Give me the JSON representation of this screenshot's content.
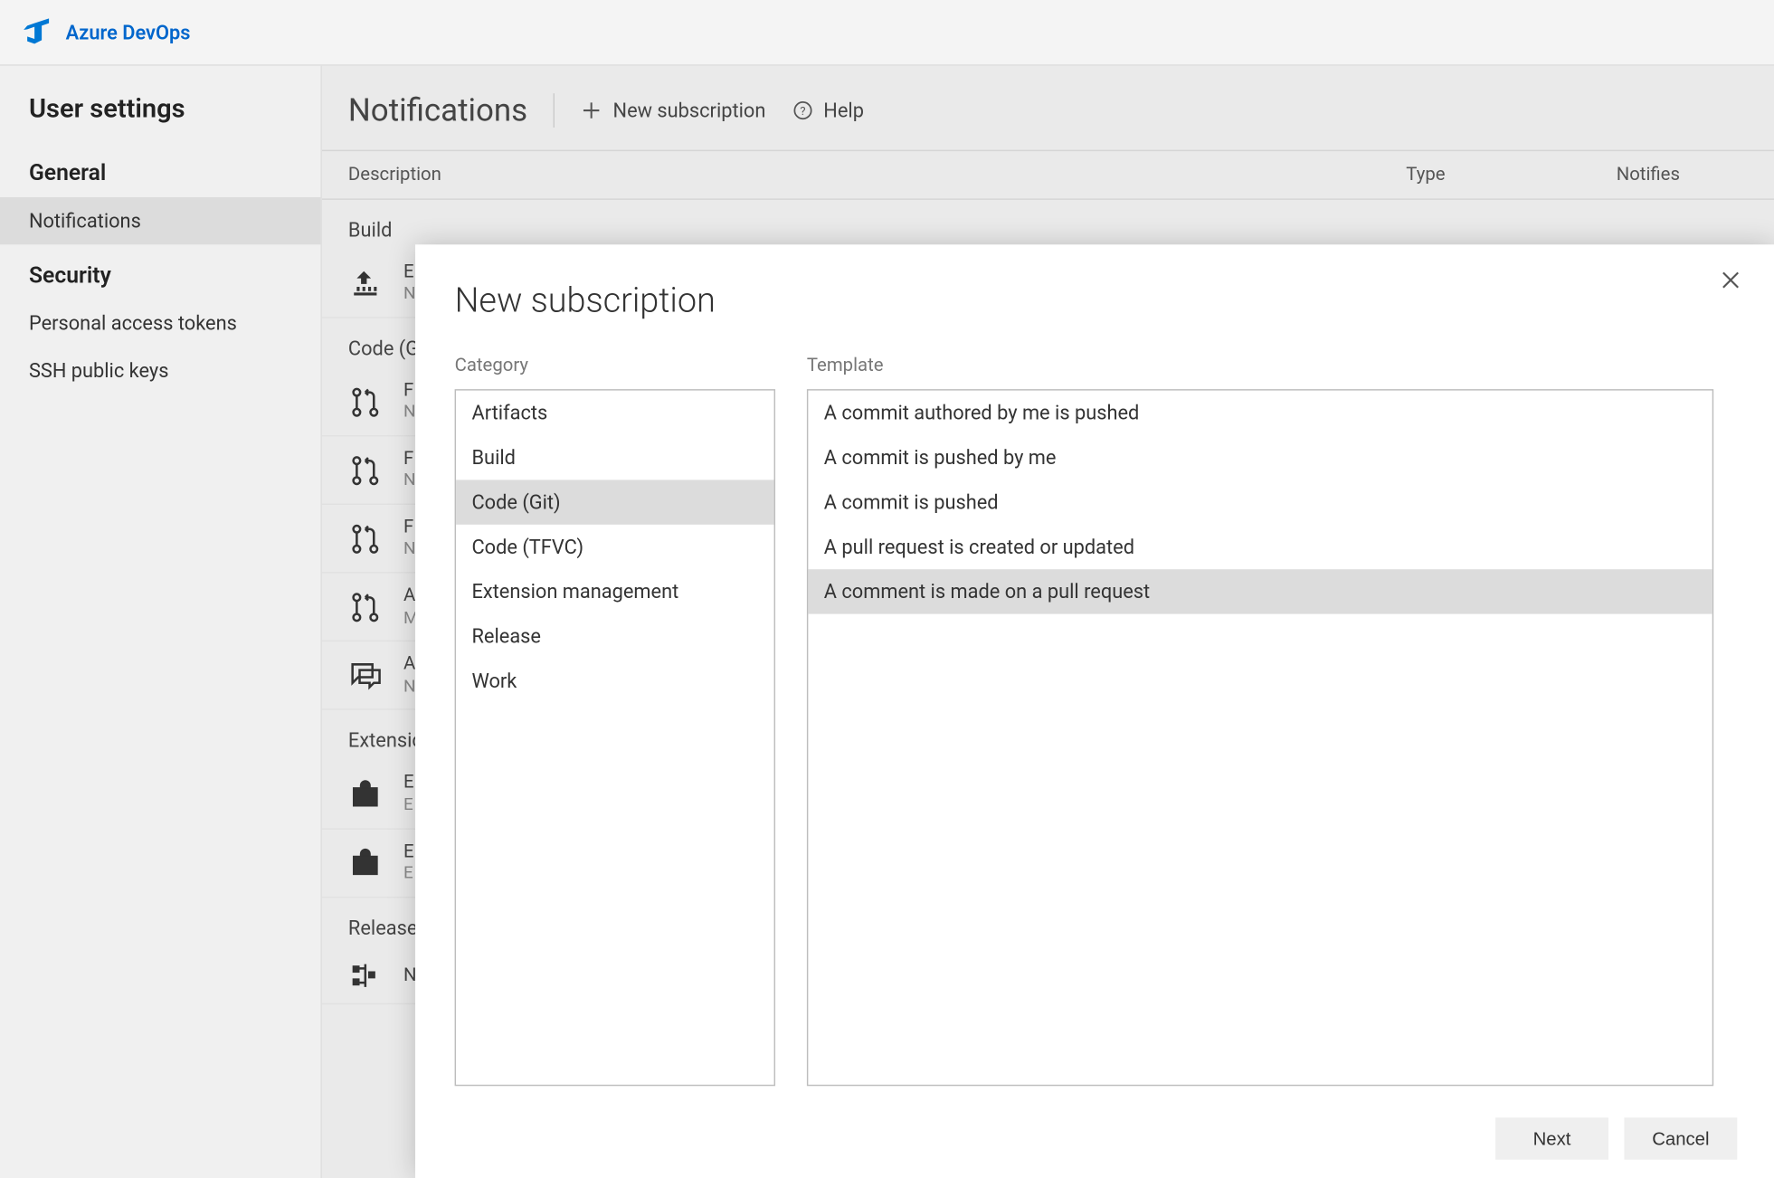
{
  "brand": "Azure DevOps",
  "sidebar": {
    "title": "User settings",
    "groups": [
      {
        "title": "General",
        "items": [
          {
            "label": "Notifications",
            "selected": true
          }
        ]
      },
      {
        "title": "Security",
        "items": [
          {
            "label": "Personal access tokens",
            "selected": false
          },
          {
            "label": "SSH public keys",
            "selected": false
          }
        ]
      }
    ]
  },
  "page": {
    "title": "Notifications",
    "actions": {
      "new": "New subscription",
      "help": "Help"
    },
    "columns": {
      "desc": "Description",
      "type": "Type",
      "notifies": "Notifies"
    },
    "groups": [
      {
        "label": "Build",
        "rows": [
          {
            "icon": "build",
            "title": "E",
            "sub": "N"
          }
        ]
      },
      {
        "label": "Code (G",
        "rows": [
          {
            "icon": "pr",
            "title": "F",
            "sub": "N"
          },
          {
            "icon": "pr",
            "title": "F",
            "sub": "N"
          },
          {
            "icon": "pr",
            "title": "F",
            "sub": "N"
          },
          {
            "icon": "pr",
            "title": "A",
            "sub": "M"
          },
          {
            "icon": "comment",
            "title": "A",
            "sub": "N"
          }
        ]
      },
      {
        "label": "Extensic",
        "rows": [
          {
            "icon": "bag",
            "title": "E",
            "sub": "E"
          },
          {
            "icon": "bag",
            "title": "E",
            "sub": "E"
          }
        ]
      },
      {
        "label": "Release",
        "rows": [
          {
            "icon": "release",
            "title": "N",
            "sub": ""
          }
        ]
      }
    ]
  },
  "modal": {
    "title": "New subscription",
    "category_label": "Category",
    "template_label": "Template",
    "categories": [
      {
        "label": "Artifacts",
        "selected": false
      },
      {
        "label": "Build",
        "selected": false
      },
      {
        "label": "Code (Git)",
        "selected": true
      },
      {
        "label": "Code (TFVC)",
        "selected": false
      },
      {
        "label": "Extension management",
        "selected": false
      },
      {
        "label": "Release",
        "selected": false
      },
      {
        "label": "Work",
        "selected": false
      }
    ],
    "templates": [
      {
        "label": "A commit authored by me is pushed",
        "selected": false
      },
      {
        "label": "A commit is pushed by me",
        "selected": false
      },
      {
        "label": "A commit is pushed",
        "selected": false
      },
      {
        "label": "A pull request is created or updated",
        "selected": false
      },
      {
        "label": "A comment is made on a pull request",
        "selected": true
      }
    ],
    "buttons": {
      "next": "Next",
      "cancel": "Cancel"
    }
  }
}
